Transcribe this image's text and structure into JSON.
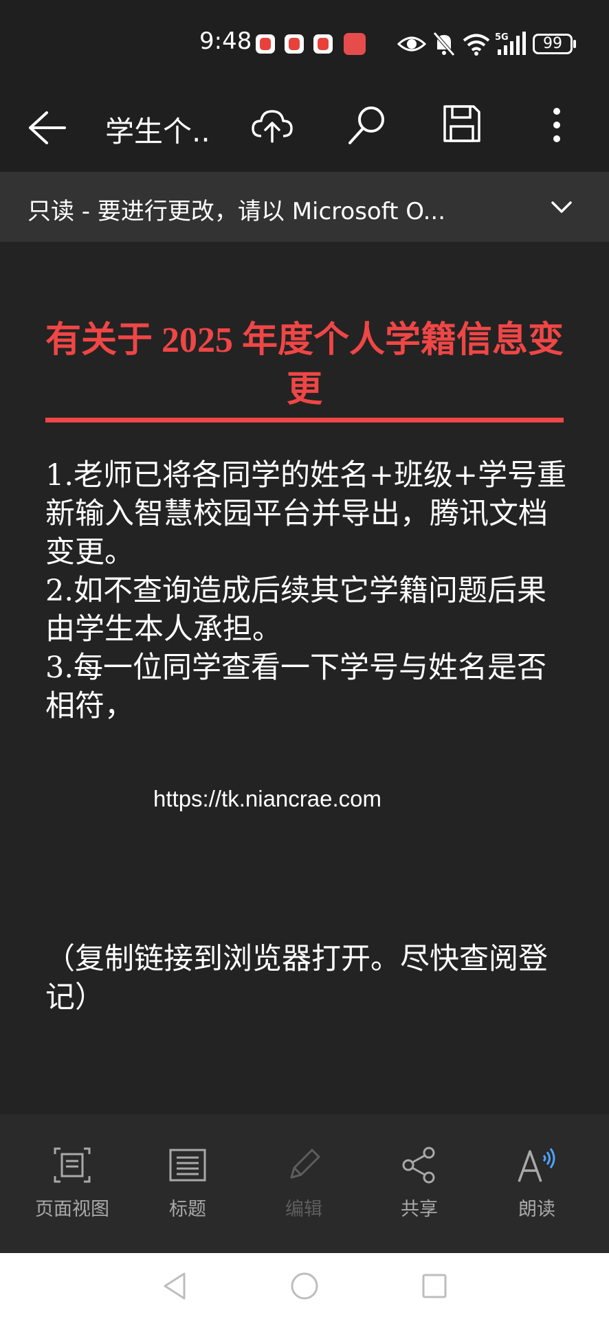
{
  "status_bar": {
    "time": "9:48",
    "battery": "99",
    "icons": [
      "eye-icon",
      "mute-icon",
      "wifi-icon",
      "5g-signal-icon",
      "battery-icon"
    ]
  },
  "toolbar": {
    "doc_title": "学生个..",
    "icons": [
      "back-arrow-icon",
      "cloud-upload-icon",
      "search-icon",
      "save-icon",
      "more-vertical-icon"
    ]
  },
  "banner": {
    "text": "只读 - 要进行更改，请以 Microsoft O..."
  },
  "document": {
    "heading": "有关于  2025  年度个人学籍信息变更",
    "paragraphs": [
      "1.老师已将各同学的姓名+班级+学号重新输入智慧校园平台并导出，腾讯文档变更。",
      "2.如不查询造成后续其它学籍问题后果由学生本人承担。",
      "3.每一位同学查看一下学号与姓名是否相符，"
    ],
    "link": "https://tk.niancrae.com",
    "note": "（复制链接到浏览器打开。尽快查阅登记）"
  },
  "bottom_bar": {
    "items": [
      {
        "label": "页面视图",
        "icon": "page-view-icon"
      },
      {
        "label": "标题",
        "icon": "headings-icon"
      },
      {
        "label": "编辑",
        "icon": "pencil-icon"
      },
      {
        "label": "共享",
        "icon": "share-icon"
      },
      {
        "label": "朗读",
        "icon": "read-aloud-icon"
      }
    ]
  },
  "nav_bar": {
    "icons": [
      "nav-back-icon",
      "nav-home-icon",
      "nav-recents-icon"
    ]
  },
  "colors": {
    "heading_red": "#f04646",
    "background": "#232323",
    "toolbar": "#1f1f1f",
    "banner": "#333333"
  }
}
